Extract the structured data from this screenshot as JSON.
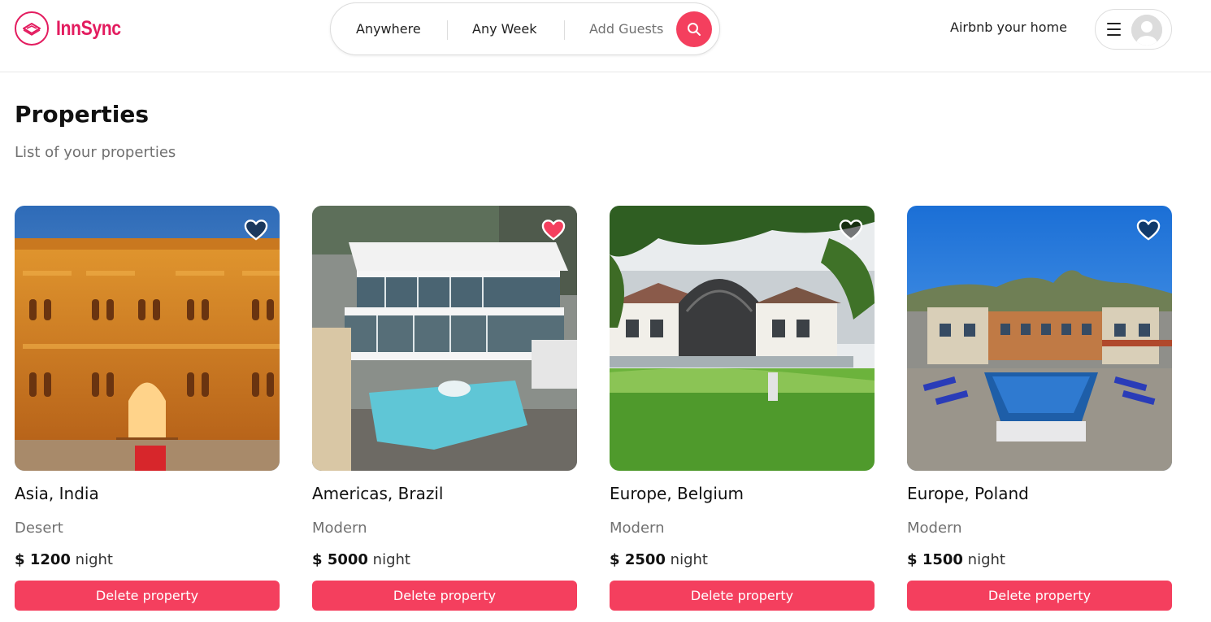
{
  "header": {
    "logo_text": "InnSync",
    "search": {
      "anywhere": "Anywhere",
      "week": "Any Week",
      "guests": "Add Guests"
    },
    "host_link": "Airbnb your home"
  },
  "page": {
    "title": "Properties",
    "subtitle": "List of your properties"
  },
  "properties": [
    {
      "location": "Asia, India",
      "category": "Desert",
      "currency": "$",
      "price": "1200",
      "unit": "night",
      "favorited": false,
      "action": "Delete property"
    },
    {
      "location": "Americas, Brazil",
      "category": "Modern",
      "currency": "$",
      "price": "5000",
      "unit": "night",
      "favorited": true,
      "action": "Delete property"
    },
    {
      "location": "Europe, Belgium",
      "category": "Modern",
      "currency": "$",
      "price": "2500",
      "unit": "night",
      "favorited": false,
      "action": "Delete property"
    },
    {
      "location": "Europe, Poland",
      "category": "Modern",
      "currency": "$",
      "price": "1500",
      "unit": "night",
      "favorited": false,
      "action": "Delete property"
    }
  ],
  "colors": {
    "brand": "#e31c5f",
    "accent": "#f43f5e",
    "muted_text": "#717171"
  }
}
